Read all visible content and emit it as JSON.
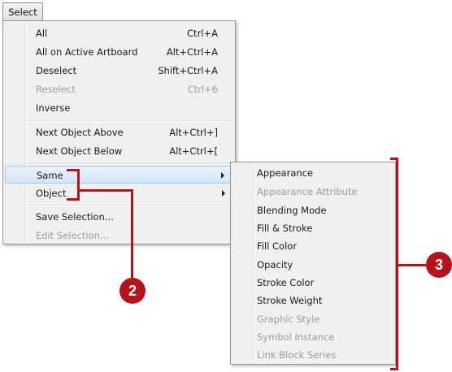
{
  "menubar": {
    "title": "Select"
  },
  "main_menu": {
    "items": [
      {
        "label": "All",
        "shortcut": "Ctrl+A"
      },
      {
        "label": "All on Active Artboard",
        "shortcut": "Alt+Ctrl+A"
      },
      {
        "label": "Deselect",
        "shortcut": "Shift+Ctrl+A"
      },
      {
        "label": "Reselect",
        "shortcut": "Ctrl+6",
        "disabled": true
      },
      {
        "label": "Inverse",
        "shortcut": ""
      },
      {
        "label": "Next Object Above",
        "shortcut": "Alt+Ctrl+]"
      },
      {
        "label": "Next Object Below",
        "shortcut": "Alt+Ctrl+["
      },
      {
        "label": "Same",
        "has_submenu": true,
        "highlighted": true
      },
      {
        "label": "Object",
        "has_submenu": true
      },
      {
        "label": "Save Selection...",
        "shortcut": ""
      },
      {
        "label": "Edit Selection...",
        "shortcut": "",
        "disabled": true
      }
    ]
  },
  "same_submenu": {
    "items": [
      {
        "label": "Appearance"
      },
      {
        "label": "Appearance Attribute",
        "disabled": true
      },
      {
        "label": "Blending Mode"
      },
      {
        "label": "Fill & Stroke"
      },
      {
        "label": "Fill Color"
      },
      {
        "label": "Opacity"
      },
      {
        "label": "Stroke Color"
      },
      {
        "label": "Stroke Weight"
      },
      {
        "label": "Graphic Style",
        "disabled": true
      },
      {
        "label": "Symbol Instance",
        "disabled": true
      },
      {
        "label": "Link Block Series",
        "disabled": true
      }
    ]
  },
  "callouts": {
    "step_2": "2",
    "step_3": "3"
  },
  "colors": {
    "callout": "#b5121b",
    "highlight": "#d3e6f9",
    "disabled_text": "#9d9d9d"
  }
}
